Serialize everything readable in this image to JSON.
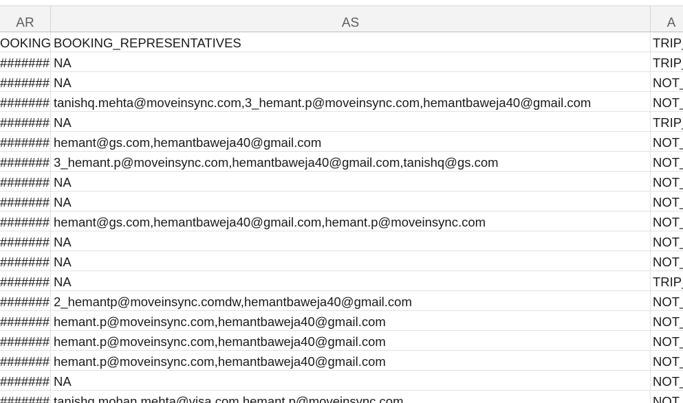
{
  "columns": {
    "ar": "AR",
    "as": "AS",
    "at": "A"
  },
  "rows": [
    {
      "ar": "OOKING_",
      "as": "BOOKING_REPRESENTATIVES",
      "at": "TRIP_"
    },
    {
      "ar": "#######",
      "as": "NA",
      "at": "TRIP_"
    },
    {
      "ar": "#######",
      "as": "NA",
      "at": "NOT_"
    },
    {
      "ar": "#######",
      "as": "tanishq.mehta@moveinsync.com,3_hemant.p@moveinsync.com,hemantbaweja40@gmail.com",
      "at": "NOT_"
    },
    {
      "ar": "#######",
      "as": "NA",
      "at": "TRIP_"
    },
    {
      "ar": "#######",
      "as": "hemant@gs.com,hemantbaweja40@gmail.com",
      "at": "NOT_"
    },
    {
      "ar": "#######",
      "as": "3_hemant.p@moveinsync.com,hemantbaweja40@gmail.com,tanishq@gs.com",
      "at": "NOT_"
    },
    {
      "ar": "#######",
      "as": "NA",
      "at": "NOT_"
    },
    {
      "ar": "#######",
      "as": "NA",
      "at": "NOT_"
    },
    {
      "ar": "#######",
      "as": "hemant@gs.com,hemantbaweja40@gmail.com,hemant.p@moveinsync.com",
      "at": "NOT_"
    },
    {
      "ar": "#######",
      "as": "NA",
      "at": "NOT_"
    },
    {
      "ar": "#######",
      "as": "NA",
      "at": "NOT_"
    },
    {
      "ar": "#######",
      "as": "NA",
      "at": "TRIP_"
    },
    {
      "ar": "#######",
      "as": "2_hemantp@moveinsync.comdw,hemantbaweja40@gmail.com",
      "at": "NOT_"
    },
    {
      "ar": "#######",
      "as": "hemant.p@moveinsync.com,hemantbaweja40@gmail.com",
      "at": "NOT_"
    },
    {
      "ar": "#######",
      "as": "hemant.p@moveinsync.com,hemantbaweja40@gmail.com",
      "at": "NOT_"
    },
    {
      "ar": "#######",
      "as": "hemant.p@moveinsync.com,hemantbaweja40@gmail.com",
      "at": "NOT_"
    },
    {
      "ar": "#######",
      "as": "NA",
      "at": "NOT_"
    },
    {
      "ar": "#######",
      "as": "tanishq.mohan.mehta@visa.com,hemant.p@moveinsync.com",
      "at": "NOT_"
    }
  ]
}
